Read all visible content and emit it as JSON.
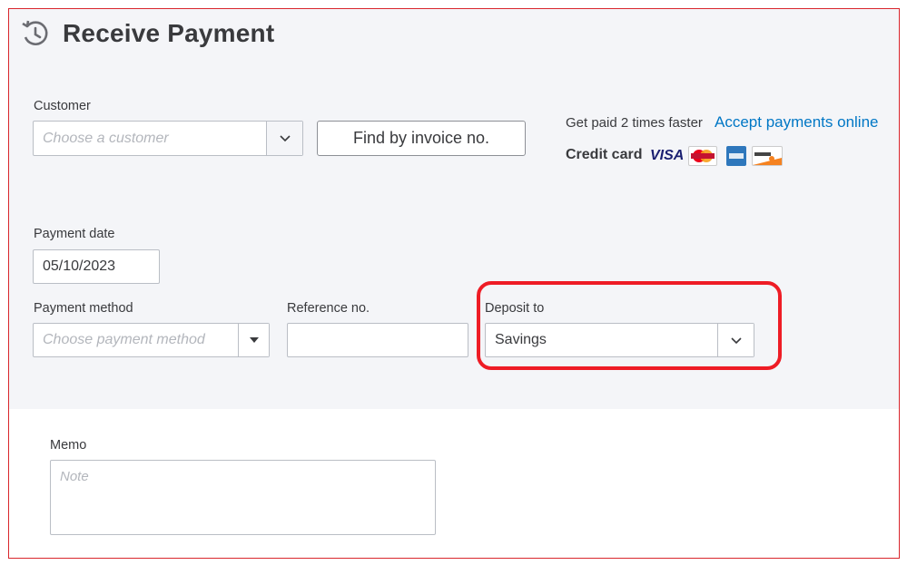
{
  "header": {
    "title": "Receive Payment",
    "icon": "clock-refresh-icon"
  },
  "customer": {
    "label": "Customer",
    "placeholder": "Choose a customer"
  },
  "find_button": {
    "label": "Find by invoice no."
  },
  "promo": {
    "text": "Get paid 2 times faster",
    "link": "Accept payments online",
    "credit_card_label": "Credit card",
    "card_brands": [
      "VISA",
      "MasterCard",
      "American Express",
      "DISCOVER"
    ]
  },
  "payment_date": {
    "label": "Payment date",
    "value": "05/10/2023"
  },
  "payment_method": {
    "label": "Payment method",
    "placeholder": "Choose payment method"
  },
  "reference": {
    "label": "Reference no.",
    "value": ""
  },
  "deposit": {
    "label": "Deposit to",
    "value": "Savings"
  },
  "memo": {
    "label": "Memo",
    "placeholder": "Note"
  },
  "colors": {
    "link": "#0077c5",
    "highlight": "#ee1c25",
    "panel": "#f4f5f8"
  }
}
